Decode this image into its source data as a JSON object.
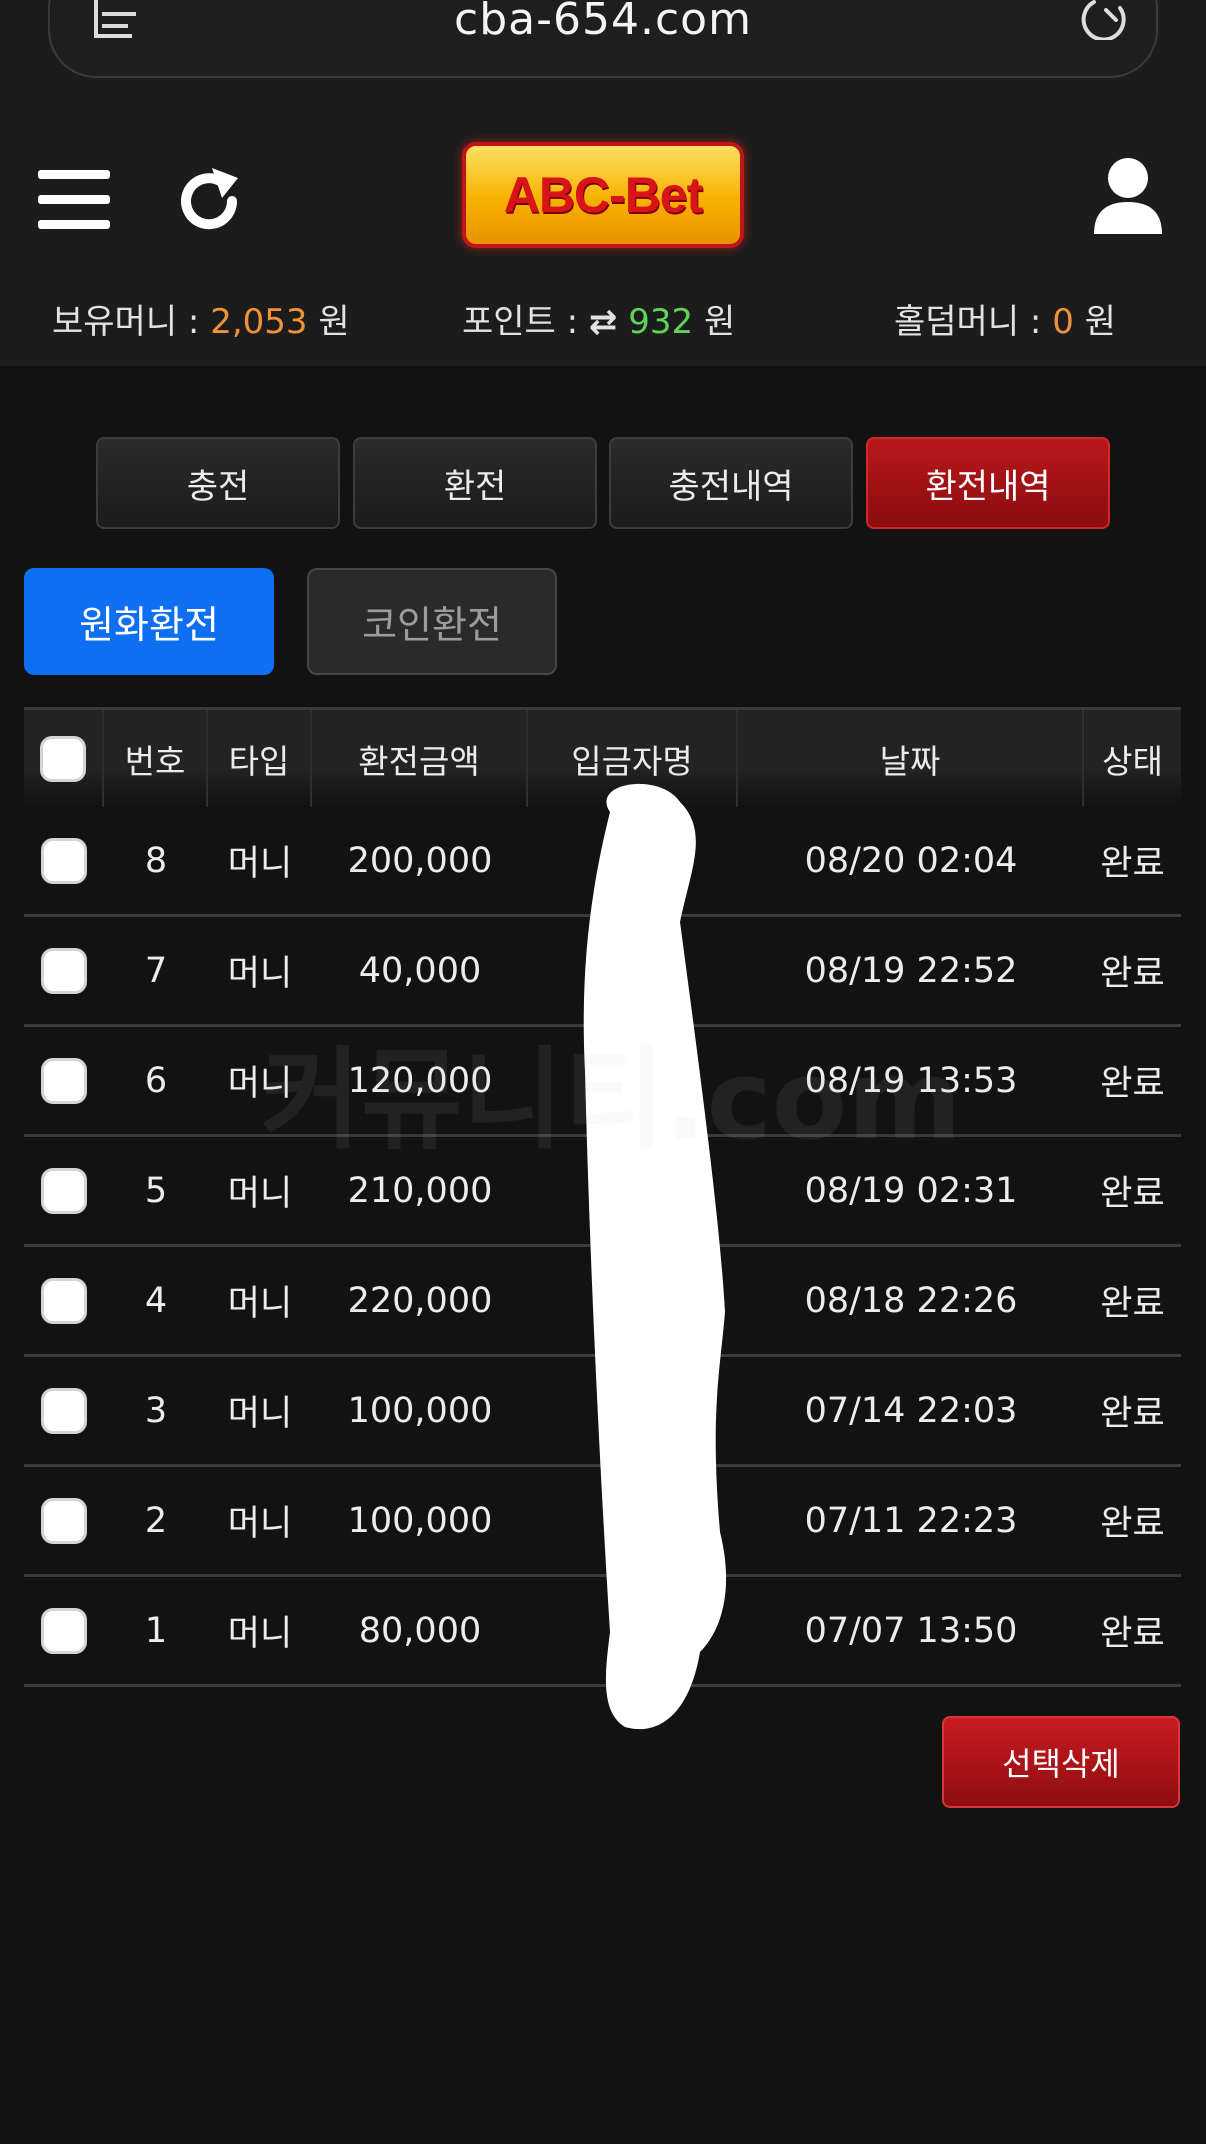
{
  "browser": {
    "url": "cba-654.com",
    "reader_icon": "reader-mode-icon",
    "reload_icon": "reload-icon"
  },
  "header": {
    "logo_text": "ABC-Bet",
    "menu_icon": "hamburger-menu-icon",
    "refresh_icon": "refresh-icon",
    "user_icon": "user-profile-icon"
  },
  "balances": {
    "money_label": "보유머니 : ",
    "money_value": "2,053",
    "points_label": "포인트 : ",
    "points_icon": "⇄",
    "points_value": "932",
    "holdem_label": "홀덤머니 : ",
    "holdem_value": "0",
    "unit": " 원"
  },
  "tabs": [
    {
      "label": "충전",
      "active": false
    },
    {
      "label": "환전",
      "active": false
    },
    {
      "label": "충전내역",
      "active": false
    },
    {
      "label": "환전내역",
      "active": true
    }
  ],
  "subtabs": [
    {
      "label": "원화환전",
      "active": true
    },
    {
      "label": "코인환전",
      "active": false
    }
  ],
  "table": {
    "headers": [
      "번호",
      "타입",
      "환전금액",
      "입금자명",
      "날짜",
      "상태"
    ],
    "rows": [
      {
        "no": "8",
        "type": "머니",
        "amount": "200,000",
        "name": "",
        "date": "08/20 02:04",
        "status": "완료"
      },
      {
        "no": "7",
        "type": "머니",
        "amount": "40,000",
        "name": "",
        "date": "08/19 22:52",
        "status": "완료"
      },
      {
        "no": "6",
        "type": "머니",
        "amount": "120,000",
        "name": "",
        "date": "08/19 13:53",
        "status": "완료"
      },
      {
        "no": "5",
        "type": "머니",
        "amount": "210,000",
        "name": "",
        "date": "08/19 02:31",
        "status": "완료"
      },
      {
        "no": "4",
        "type": "머니",
        "amount": "220,000",
        "name": "",
        "date": "08/18 22:26",
        "status": "완료"
      },
      {
        "no": "3",
        "type": "머니",
        "amount": "100,000",
        "name": "",
        "date": "07/14 22:03",
        "status": "완료"
      },
      {
        "no": "2",
        "type": "머니",
        "amount": "100,000",
        "name": "",
        "date": "07/11 22:23",
        "status": "완료"
      },
      {
        "no": "1",
        "type": "머니",
        "amount": "80,000",
        "name": "",
        "date": "07/07 13:50",
        "status": "완료"
      }
    ]
  },
  "watermark": "커뮤니티.com",
  "delete_button": "선택삭제",
  "colors": {
    "accent_red": "#b9181b",
    "accent_blue": "#0f6ff2",
    "money_orange": "#f0923a",
    "points_green": "#5fd35a",
    "background": "#121212"
  }
}
